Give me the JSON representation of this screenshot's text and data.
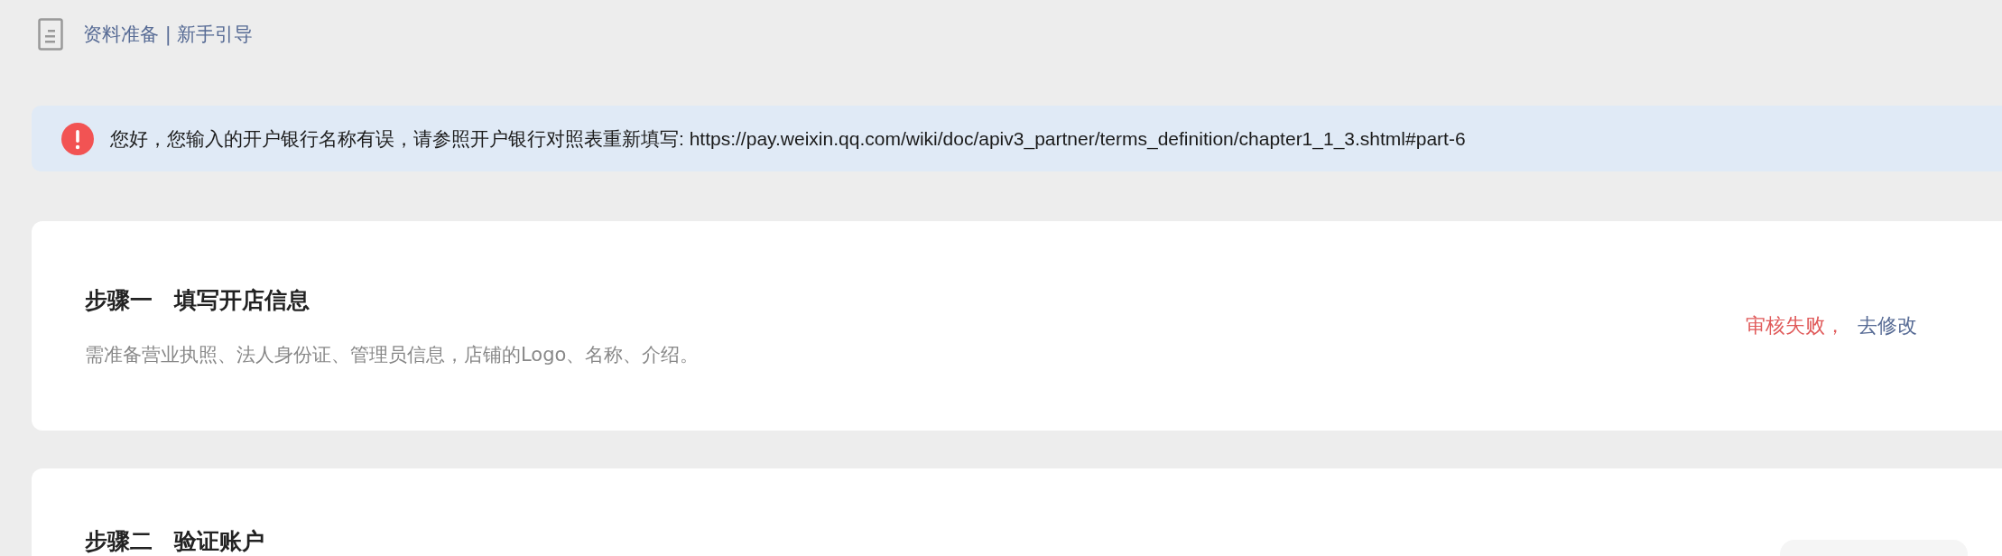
{
  "header": {
    "title": "资料准备 | 新手引导"
  },
  "alert": {
    "kind": "error",
    "message": "您好，您输入的开户银行名称有误，请参照开户银行对照表重新填写: https://pay.weixin.qq.com/wiki/doc/apiv3_partner/terms_definition/chapter1_1_3.shtml#part-6"
  },
  "steps": [
    {
      "label": "步骤一",
      "title": "填写开店信息",
      "description": "需准备营业执照、法人身份证、管理员信息，店铺的Logo、名称、介绍。",
      "status": "审核失败，",
      "action": "去修改",
      "kind": "failed"
    },
    {
      "label": "步骤二",
      "title": "验证账户",
      "kind": "pending"
    }
  ]
}
